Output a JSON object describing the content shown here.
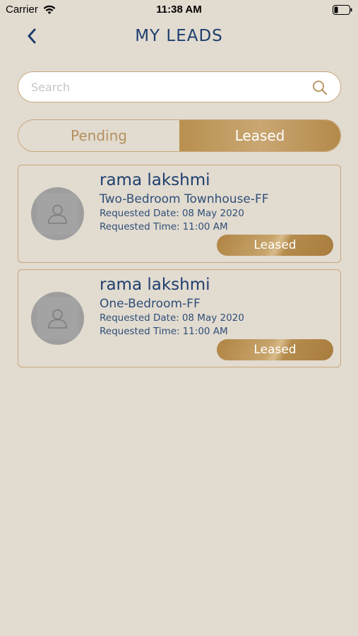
{
  "status_bar": {
    "carrier": "Carrier",
    "time": "11:38 AM"
  },
  "header": {
    "title": "MY LEADS"
  },
  "search": {
    "placeholder": "Search",
    "value": ""
  },
  "tabs": {
    "pending": "Pending",
    "leased": "Leased",
    "selected": "Leased"
  },
  "leads": [
    {
      "name": "rama lakshmi",
      "unit": "Two-Bedroom Townhouse-FF",
      "date_label": "Requested Date:",
      "date": "08 May 2020",
      "time_label": "Requested Time:",
      "time": "11:00 AM",
      "status": "Leased"
    },
    {
      "name": "rama lakshmi",
      "unit": "One-Bedroom-FF",
      "date_label": "Requested Date:",
      "date": "08 May 2020",
      "time_label": "Requested Time:",
      "time": "11:00 AM",
      "status": "Leased"
    }
  ],
  "colors": {
    "background": "#e2dbd0",
    "accent_gold": "#c29c62",
    "title_blue": "#1d3f6e"
  },
  "icons": {
    "back": "chevron-left-icon",
    "search": "search-icon",
    "avatar": "user-placeholder-icon",
    "wifi": "wifi-icon",
    "battery": "battery-icon"
  }
}
